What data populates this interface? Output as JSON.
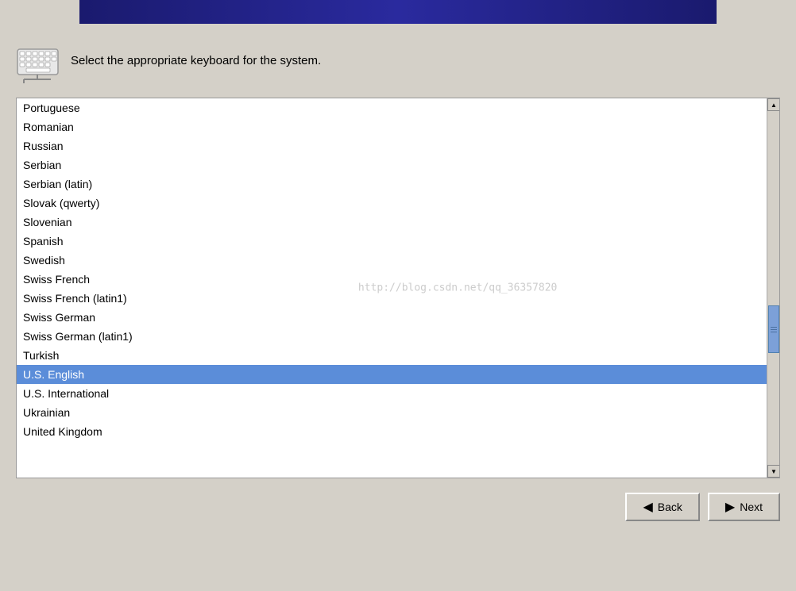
{
  "header": {
    "title": "Select the appropriate keyboard for the system."
  },
  "watermark": "http://blog.csdn.net/qq_36357820",
  "keyboard_layouts": [
    "Portuguese",
    "Romanian",
    "Russian",
    "Serbian",
    "Serbian (latin)",
    "Slovak (qwerty)",
    "Slovenian",
    "Spanish",
    "Swedish",
    "Swiss French",
    "Swiss French (latin1)",
    "Swiss German",
    "Swiss German (latin1)",
    "Turkish",
    "U.S. English",
    "U.S. International",
    "Ukrainian",
    "United Kingdom"
  ],
  "selected_item": "U.S. English",
  "buttons": {
    "back_label": "Back",
    "next_label": "Next"
  }
}
